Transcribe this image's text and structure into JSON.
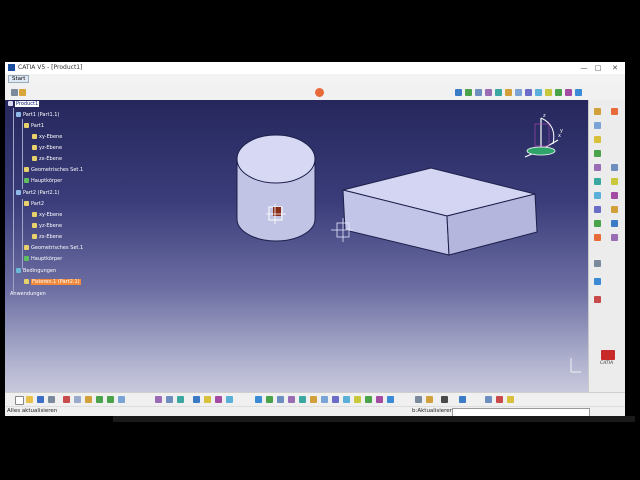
{
  "window": {
    "title": "CATIA V5 - [Product1]",
    "controls": [
      "—",
      "□",
      "✕"
    ]
  },
  "menu": {
    "start_label": "Start"
  },
  "tree": {
    "nodes": [
      "Product1",
      "Part1 (Part1.1)",
      "Part1",
      "xy-Ebene",
      "yz-Ebene",
      "zx-Ebene",
      "Geometrisches Set.1",
      "Hauptkörper",
      "Part2 (Part2.1)",
      "Part2",
      "xy-Ebene",
      "yz-Ebene",
      "zx-Ebene",
      "Geometrisches Set.1",
      "Hauptkörper",
      "Bedingungen",
      "Fixieren.1 (Part2.1)",
      "Anwendungen"
    ]
  },
  "compass": {
    "axes": [
      "z",
      "y",
      "x"
    ]
  },
  "status": {
    "left_text": "Alles aktualisieren",
    "right_text": "b:Aktualisieren"
  },
  "logo": {
    "text": "CATIA"
  },
  "colors": {
    "viewport_top": "#25275c",
    "viewport_bottom": "#c8c9dc",
    "part_face": "#c9cbea",
    "selection_orange": "#f08a3a"
  }
}
